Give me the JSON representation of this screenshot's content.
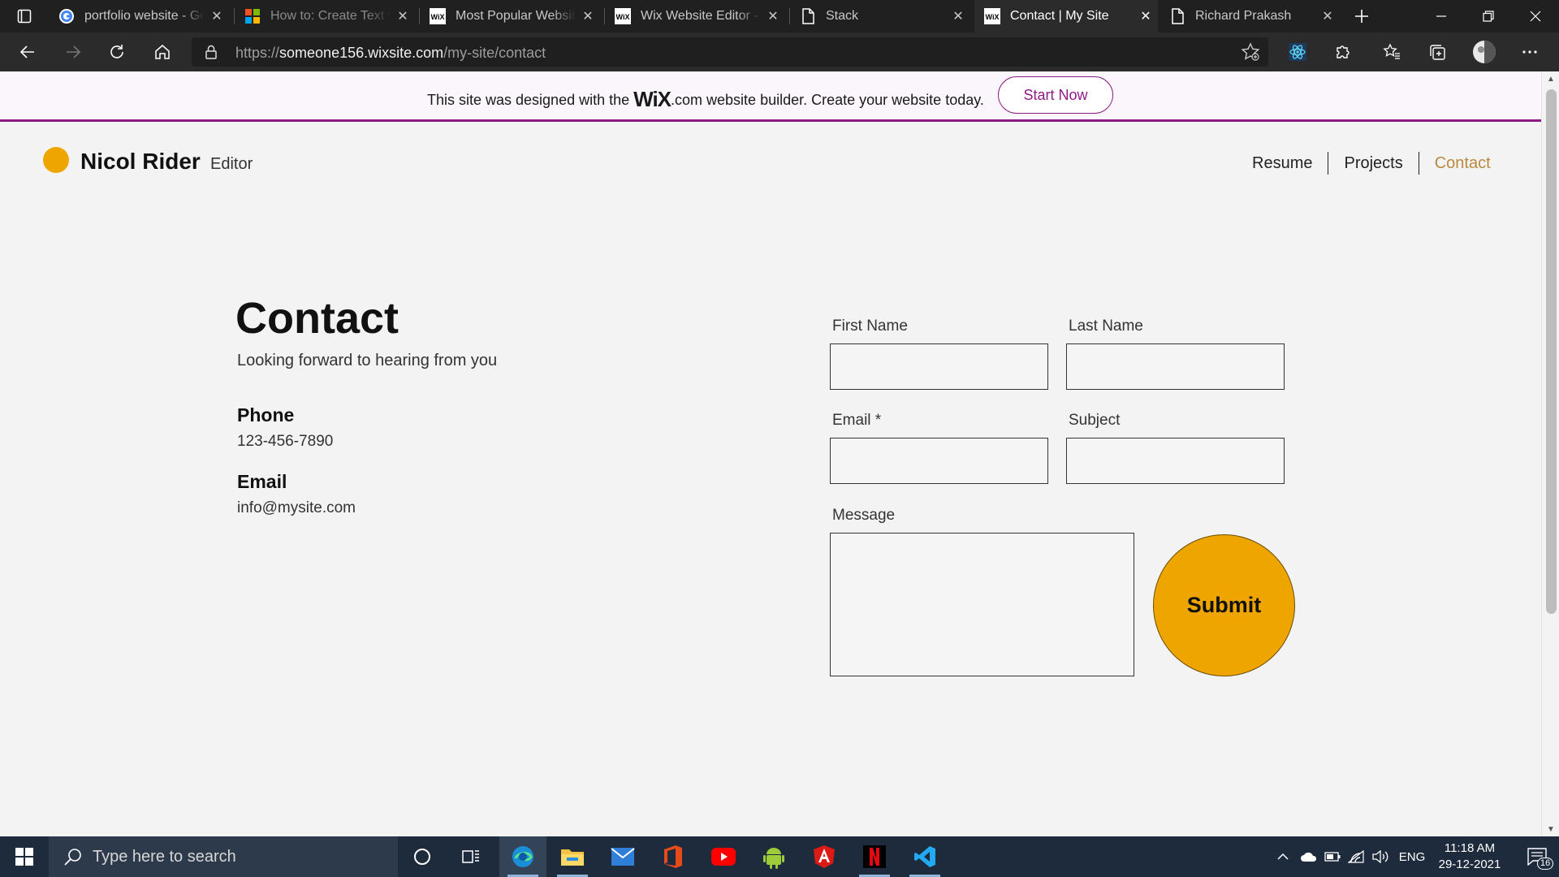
{
  "browser": {
    "tabs": [
      {
        "title": "portfolio website - Go",
        "favicon": "google-icon",
        "active": false
      },
      {
        "title": "How to: Create Text w",
        "favicon": "microsoft-icon",
        "active": false
      },
      {
        "title": "Most Popular Website",
        "favicon": "wix-icon",
        "active": false
      },
      {
        "title": "Wix Website Editor - r",
        "favicon": "wix-icon",
        "active": false
      },
      {
        "title": "Stack",
        "favicon": "page-icon",
        "active": false
      },
      {
        "title": "Contact | My Site",
        "favicon": "wix-icon",
        "active": true
      },
      {
        "title": "Richard Prakash",
        "favicon": "page-icon",
        "active": false
      }
    ],
    "wix_favicon_text": "WiX",
    "url_scheme": "https://",
    "url_host": "someone156.wixsite.com",
    "url_path": "/my-site/contact",
    "profile_initial": ""
  },
  "banner": {
    "text_before": "This site was designed with the ",
    "logo": "WiX",
    "text_after": ".com website builder. Create your website today.",
    "cta": "Start Now"
  },
  "site": {
    "brand_name": "Nicol Rider",
    "brand_role": "Editor",
    "nav": [
      "Resume",
      "Projects",
      "Contact"
    ],
    "title": "Contact",
    "subtitle": "Looking forward to hearing from you",
    "phone_label": "Phone",
    "phone": "123-456-7890",
    "email_label": "Email",
    "email": "info@mysite.com",
    "form": {
      "first_name": "First Name",
      "last_name": "Last Name",
      "email": "Email *",
      "subject": "Subject",
      "message": "Message",
      "submit": "Submit"
    },
    "colors": {
      "accent": "#efa500",
      "wix_purple": "#8e1a86",
      "nav_active": "#b98a3d"
    }
  },
  "taskbar": {
    "search_placeholder": "Type here to search",
    "lang": "ENG",
    "time": "11:18 AM",
    "date": "29-12-2021",
    "notifications": "16"
  }
}
